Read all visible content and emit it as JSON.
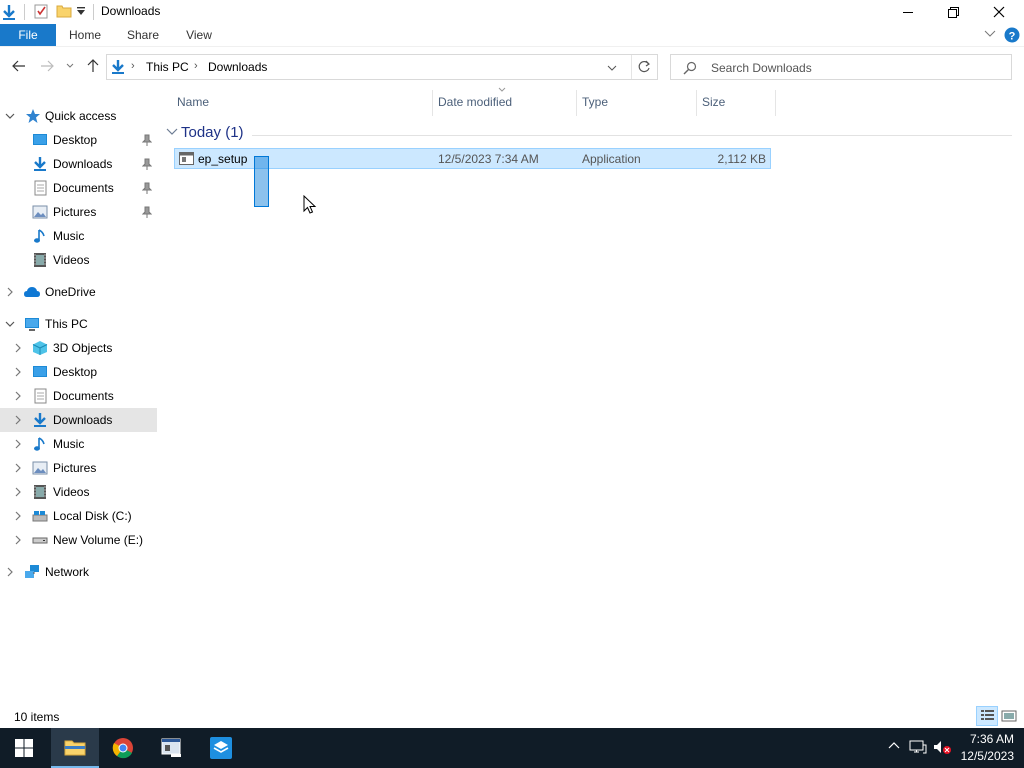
{
  "window": {
    "title": "Downloads"
  },
  "ribbon": {
    "tabs": [
      "File",
      "Home",
      "Share",
      "View"
    ]
  },
  "address": {
    "crumbs": [
      "This PC",
      "Downloads"
    ],
    "search_placeholder": "Search Downloads"
  },
  "nav": {
    "quick_access": "Quick access",
    "qa_items": [
      "Desktop",
      "Downloads",
      "Documents",
      "Pictures",
      "Music",
      "Videos"
    ],
    "onedrive": "OneDrive",
    "this_pc": "This PC",
    "pc_items": [
      "3D Objects",
      "Desktop",
      "Documents",
      "Downloads",
      "Music",
      "Pictures",
      "Videos",
      "Local Disk (C:)",
      "New Volume (E:)"
    ],
    "network": "Network"
  },
  "columns": {
    "name": "Name",
    "date": "Date modified",
    "type": "Type",
    "size": "Size"
  },
  "group": {
    "label": "Today (1)"
  },
  "files": [
    {
      "name": "ep_setup",
      "date": "12/5/2023 7:34 AM",
      "type": "Application",
      "size": "2,112 KB"
    }
  ],
  "status": {
    "items": "10 items"
  },
  "taskbar": {
    "time": "7:36 AM",
    "date": "12/5/2023"
  },
  "colors": {
    "accent": "#1979ca",
    "selection": "#cce8ff",
    "taskbar": "#101c27"
  }
}
